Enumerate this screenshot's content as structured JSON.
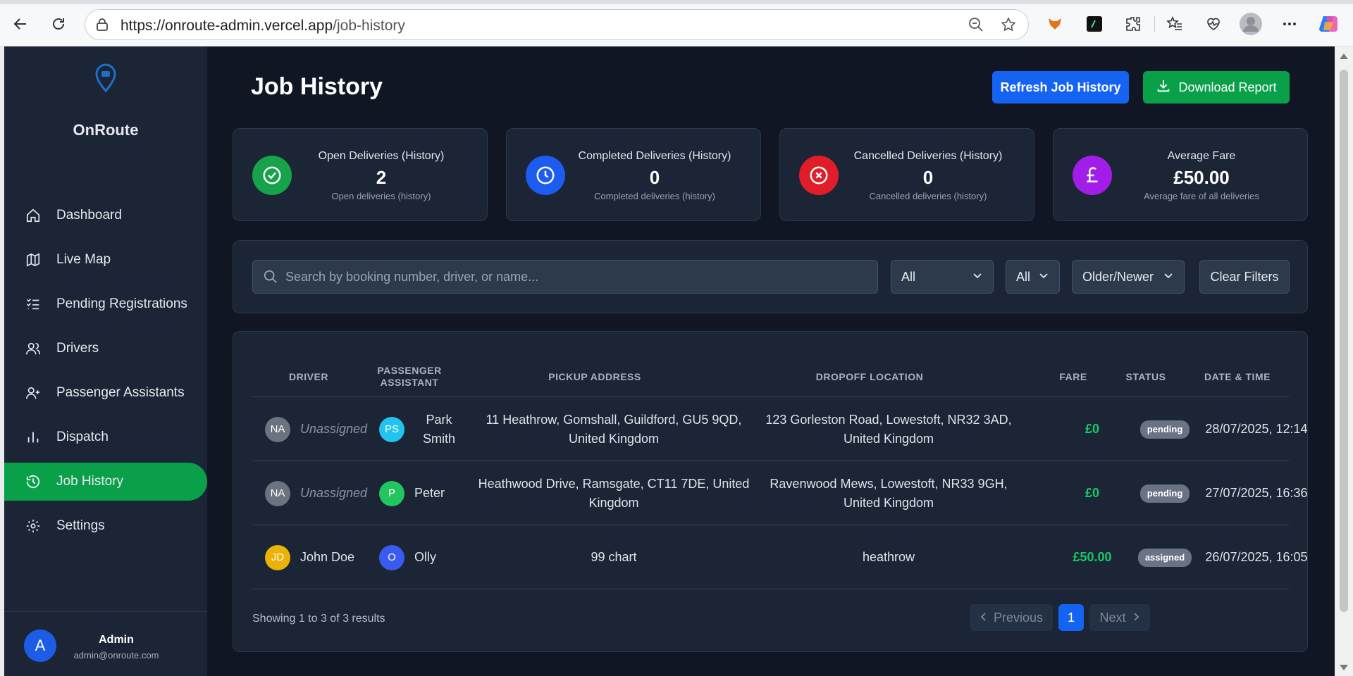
{
  "browser": {
    "url_host": "https://onroute-admin.vercel.app",
    "url_path": "/job-history"
  },
  "sidebar": {
    "brand": "OnRoute",
    "items": [
      {
        "label": "Dashboard",
        "icon": "home-icon"
      },
      {
        "label": "Live Map",
        "icon": "map-icon"
      },
      {
        "label": "Pending Registrations",
        "icon": "list-check-icon"
      },
      {
        "label": "Drivers",
        "icon": "users-icon"
      },
      {
        "label": "Passenger Assistants",
        "icon": "user-plus-icon"
      },
      {
        "label": "Dispatch",
        "icon": "bar-chart-icon"
      },
      {
        "label": "Job History",
        "icon": "history-icon",
        "active": true
      },
      {
        "label": "Settings",
        "icon": "gear-icon"
      }
    ],
    "admin": {
      "initial": "A",
      "name": "Admin",
      "email": "admin@onroute.com"
    }
  },
  "header": {
    "title": "Job History",
    "refresh_label": "Refresh Job History",
    "download_label": "Download Report"
  },
  "stats": [
    {
      "title": "Open Deliveries (History)",
      "value": "2",
      "subtitle": "Open deliveries (history)",
      "color": "#16a34a",
      "icon": "check-circle-icon"
    },
    {
      "title": "Completed Deliveries (History)",
      "value": "0",
      "subtitle": "Completed deliveries (history)",
      "color": "#1d5cf0",
      "icon": "clock-icon"
    },
    {
      "title": "Cancelled Deliveries (History)",
      "value": "0",
      "subtitle": "Cancelled deliveries (history)",
      "color": "#e11d2a",
      "icon": "x-circle-icon"
    },
    {
      "title": "Average Fare",
      "value": "£50.00",
      "subtitle": "Average fare of all deliveries",
      "color": "#a21de8",
      "icon": "pound-icon"
    }
  ],
  "filters": {
    "search_placeholder": "Search by booking number, driver, or name...",
    "status_filter": "All",
    "type_filter": "All",
    "sort": "Older/Newer",
    "clear_label": "Clear Filters"
  },
  "table": {
    "headers": [
      "DRIVER",
      "PASSENGER ASSISTANT",
      "PICKUP ADDRESS",
      "DROPOFF LOCATION",
      "FARE",
      "STATUS",
      "DATE & TIME"
    ],
    "rows": [
      {
        "driver_initials": "NA",
        "driver": "Unassigned",
        "pa_initials": "PS",
        "pa": "Park Smith",
        "pickup": "11 Heathrow, Gomshall, Guildford, GU5 9QD, United Kingdom",
        "dropoff": "123 Gorleston Road, Lowestoft, NR32 3AD, United Kingdom",
        "fare": "£0",
        "status": "pending",
        "datetime": "28/07/2025, 12:14"
      },
      {
        "driver_initials": "NA",
        "driver": "Unassigned",
        "pa_initials": "P",
        "pa": "Peter",
        "pickup": "Heathwood Drive, Ramsgate, CT11 7DE, United Kingdom",
        "dropoff": "Ravenwood Mews, Lowestoft, NR33 9GH, United Kingdom",
        "fare": "£0",
        "status": "pending",
        "datetime": "27/07/2025, 16:36"
      },
      {
        "driver_initials": "JD",
        "driver": "John Doe",
        "pa_initials": "O",
        "pa": "Olly",
        "pickup": "99 chart",
        "dropoff": "heathrow",
        "fare": "£50.00",
        "status": "assigned",
        "datetime": "26/07/2025, 16:05"
      }
    ],
    "showing": "Showing 1 to 3 of 3 results",
    "pagination": {
      "prev": "Previous",
      "page": "1",
      "next": "Next"
    }
  },
  "colors": {
    "accent": "#0aa04a",
    "primary": "#1463f3",
    "bg": "#101624",
    "panel": "#1b2535"
  }
}
